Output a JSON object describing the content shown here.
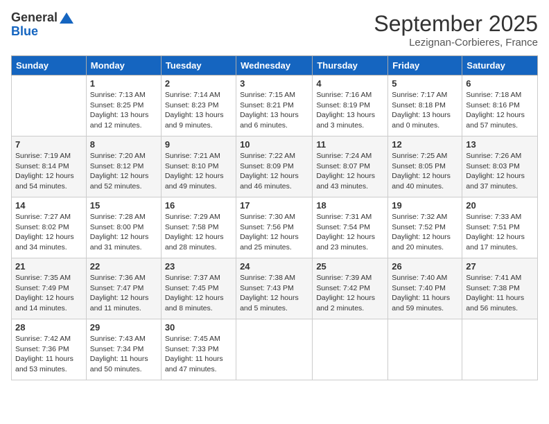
{
  "header": {
    "logo_general": "General",
    "logo_blue": "Blue",
    "month_title": "September 2025",
    "location": "Lezignan-Corbieres, France"
  },
  "days_of_week": [
    "Sunday",
    "Monday",
    "Tuesday",
    "Wednesday",
    "Thursday",
    "Friday",
    "Saturday"
  ],
  "weeks": [
    [
      {
        "day": "",
        "info": ""
      },
      {
        "day": "1",
        "info": "Sunrise: 7:13 AM\nSunset: 8:25 PM\nDaylight: 13 hours and 12 minutes."
      },
      {
        "day": "2",
        "info": "Sunrise: 7:14 AM\nSunset: 8:23 PM\nDaylight: 13 hours and 9 minutes."
      },
      {
        "day": "3",
        "info": "Sunrise: 7:15 AM\nSunset: 8:21 PM\nDaylight: 13 hours and 6 minutes."
      },
      {
        "day": "4",
        "info": "Sunrise: 7:16 AM\nSunset: 8:19 PM\nDaylight: 13 hours and 3 minutes."
      },
      {
        "day": "5",
        "info": "Sunrise: 7:17 AM\nSunset: 8:18 PM\nDaylight: 13 hours and 0 minutes."
      },
      {
        "day": "6",
        "info": "Sunrise: 7:18 AM\nSunset: 8:16 PM\nDaylight: 12 hours and 57 minutes."
      }
    ],
    [
      {
        "day": "7",
        "info": "Sunrise: 7:19 AM\nSunset: 8:14 PM\nDaylight: 12 hours and 54 minutes."
      },
      {
        "day": "8",
        "info": "Sunrise: 7:20 AM\nSunset: 8:12 PM\nDaylight: 12 hours and 52 minutes."
      },
      {
        "day": "9",
        "info": "Sunrise: 7:21 AM\nSunset: 8:10 PM\nDaylight: 12 hours and 49 minutes."
      },
      {
        "day": "10",
        "info": "Sunrise: 7:22 AM\nSunset: 8:09 PM\nDaylight: 12 hours and 46 minutes."
      },
      {
        "day": "11",
        "info": "Sunrise: 7:24 AM\nSunset: 8:07 PM\nDaylight: 12 hours and 43 minutes."
      },
      {
        "day": "12",
        "info": "Sunrise: 7:25 AM\nSunset: 8:05 PM\nDaylight: 12 hours and 40 minutes."
      },
      {
        "day": "13",
        "info": "Sunrise: 7:26 AM\nSunset: 8:03 PM\nDaylight: 12 hours and 37 minutes."
      }
    ],
    [
      {
        "day": "14",
        "info": "Sunrise: 7:27 AM\nSunset: 8:02 PM\nDaylight: 12 hours and 34 minutes."
      },
      {
        "day": "15",
        "info": "Sunrise: 7:28 AM\nSunset: 8:00 PM\nDaylight: 12 hours and 31 minutes."
      },
      {
        "day": "16",
        "info": "Sunrise: 7:29 AM\nSunset: 7:58 PM\nDaylight: 12 hours and 28 minutes."
      },
      {
        "day": "17",
        "info": "Sunrise: 7:30 AM\nSunset: 7:56 PM\nDaylight: 12 hours and 25 minutes."
      },
      {
        "day": "18",
        "info": "Sunrise: 7:31 AM\nSunset: 7:54 PM\nDaylight: 12 hours and 23 minutes."
      },
      {
        "day": "19",
        "info": "Sunrise: 7:32 AM\nSunset: 7:52 PM\nDaylight: 12 hours and 20 minutes."
      },
      {
        "day": "20",
        "info": "Sunrise: 7:33 AM\nSunset: 7:51 PM\nDaylight: 12 hours and 17 minutes."
      }
    ],
    [
      {
        "day": "21",
        "info": "Sunrise: 7:35 AM\nSunset: 7:49 PM\nDaylight: 12 hours and 14 minutes."
      },
      {
        "day": "22",
        "info": "Sunrise: 7:36 AM\nSunset: 7:47 PM\nDaylight: 12 hours and 11 minutes."
      },
      {
        "day": "23",
        "info": "Sunrise: 7:37 AM\nSunset: 7:45 PM\nDaylight: 12 hours and 8 minutes."
      },
      {
        "day": "24",
        "info": "Sunrise: 7:38 AM\nSunset: 7:43 PM\nDaylight: 12 hours and 5 minutes."
      },
      {
        "day": "25",
        "info": "Sunrise: 7:39 AM\nSunset: 7:42 PM\nDaylight: 12 hours and 2 minutes."
      },
      {
        "day": "26",
        "info": "Sunrise: 7:40 AM\nSunset: 7:40 PM\nDaylight: 11 hours and 59 minutes."
      },
      {
        "day": "27",
        "info": "Sunrise: 7:41 AM\nSunset: 7:38 PM\nDaylight: 11 hours and 56 minutes."
      }
    ],
    [
      {
        "day": "28",
        "info": "Sunrise: 7:42 AM\nSunset: 7:36 PM\nDaylight: 11 hours and 53 minutes."
      },
      {
        "day": "29",
        "info": "Sunrise: 7:43 AM\nSunset: 7:34 PM\nDaylight: 11 hours and 50 minutes."
      },
      {
        "day": "30",
        "info": "Sunrise: 7:45 AM\nSunset: 7:33 PM\nDaylight: 11 hours and 47 minutes."
      },
      {
        "day": "",
        "info": ""
      },
      {
        "day": "",
        "info": ""
      },
      {
        "day": "",
        "info": ""
      },
      {
        "day": "",
        "info": ""
      }
    ]
  ]
}
